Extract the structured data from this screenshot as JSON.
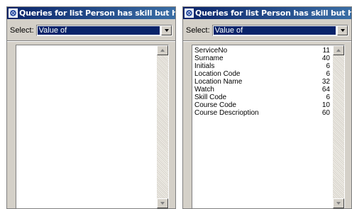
{
  "windows": [
    {
      "title": "Queries for list Person has skill but has r",
      "select_label": "Select:",
      "select_value": "Value of",
      "items": []
    },
    {
      "title": "Queries for list Person has skill but has r",
      "select_label": "Select:",
      "select_value": "Value of",
      "items": [
        {
          "name": "ServiceNo",
          "value": "11"
        },
        {
          "name": "Surname",
          "value": "40"
        },
        {
          "name": "Initials",
          "value": "6"
        },
        {
          "name": "Location Code",
          "value": "6"
        },
        {
          "name": "Location Name",
          "value": "32"
        },
        {
          "name": "Watch",
          "value": "64"
        },
        {
          "name": "Skill Code",
          "value": "6"
        },
        {
          "name": "Course Code",
          "value": "10"
        },
        {
          "name": "Course Descrioption",
          "value": "60"
        }
      ]
    }
  ],
  "icons": {
    "app": "app-icon",
    "dropdown": "chevron-down-icon",
    "scroll_up": "scroll-up-icon",
    "scroll_down": "scroll-down-icon"
  }
}
